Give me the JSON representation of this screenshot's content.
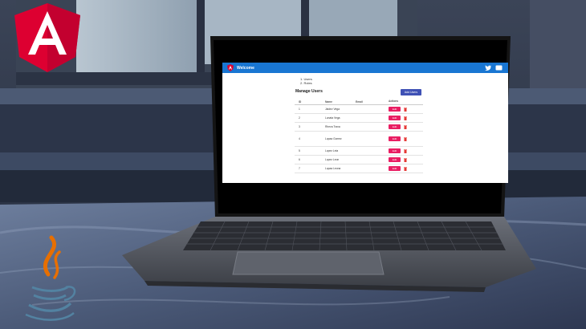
{
  "app": {
    "toolbar_title": "Welcome",
    "menu_items": [
      "1. Users",
      "2. Roles"
    ],
    "page_heading": "Manage Users",
    "add_button_label": "Add Users"
  },
  "table": {
    "headers": [
      "ID",
      "Name",
      "Email",
      "Actions"
    ],
    "rows": [
      {
        "id": "1",
        "name": "Jaidev Vega",
        "email": "",
        "edit_label": "Edit"
      },
      {
        "id": "2",
        "name": "Lunata Vega",
        "email": "",
        "edit_label": "Edit"
      },
      {
        "id": "3",
        "name": "Rheva Trava",
        "email": "",
        "edit_label": "Edit"
      },
      {
        "id": "4",
        "name": "Lupaa Gomez",
        "email": "",
        "edit_label": "Edit"
      },
      {
        "id": "5",
        "name": "Lopez Leia",
        "email": "",
        "edit_label": "Edit"
      },
      {
        "id": "6",
        "name": "Lopez Leon",
        "email": "",
        "edit_label": "Edit"
      },
      {
        "id": "7",
        "name": "Lupaa Leona",
        "email": "",
        "edit_label": "Edit"
      }
    ]
  },
  "colors": {
    "toolbar": "#1976d2",
    "add_button": "#3f51b5",
    "edit_button": "#e91e63",
    "angular_red": "#dd0031",
    "java_orange": "#e76f00",
    "java_blue": "#5382a1"
  },
  "icons": [
    "angular-logo",
    "java-logo",
    "twitter-icon",
    "chat-icon",
    "delete-icon"
  ]
}
